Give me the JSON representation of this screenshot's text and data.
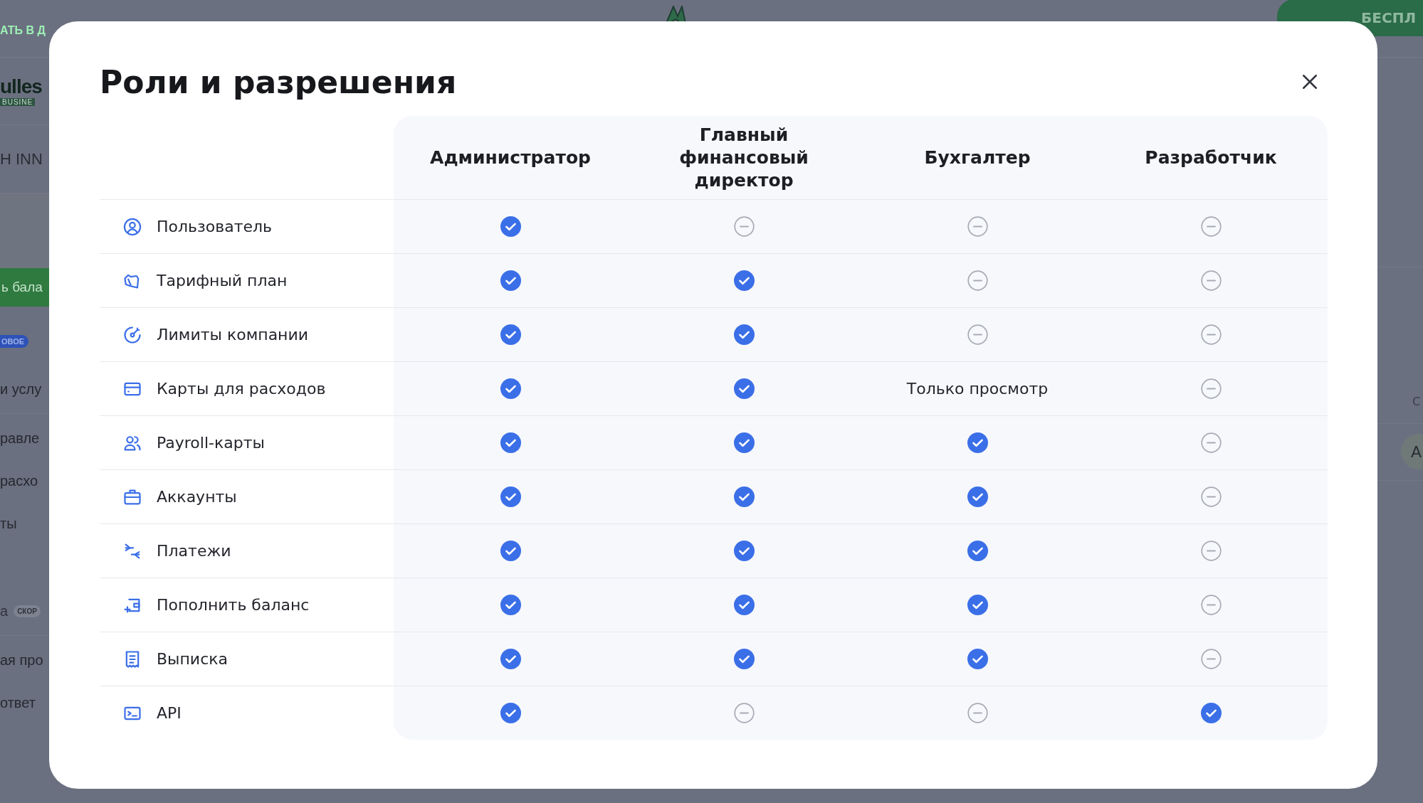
{
  "background": {
    "top_link": "АТЬ В Д",
    "trial_button": "БЕСПЛ",
    "logo": {
      "name": "ulles",
      "tag": "BUSINE"
    },
    "company": "Н INN",
    "topup_button": "ь бала",
    "sidebar": [
      {
        "kind": "badge",
        "text": "ОВОЕ"
      },
      {
        "kind": "item",
        "text": "и услу"
      },
      {
        "kind": "divider"
      },
      {
        "kind": "item",
        "text": "равле"
      },
      {
        "kind": "item",
        "text": "расхо"
      },
      {
        "kind": "item",
        "text": "ты"
      },
      {
        "kind": "item_badge",
        "text": "а",
        "badge": "СКОР"
      },
      {
        "kind": "divider"
      },
      {
        "kind": "item",
        "text": "ая про"
      },
      {
        "kind": "item",
        "text": "ответ"
      }
    ],
    "right": {
      "label": "С",
      "avatar": "А"
    }
  },
  "dialog": {
    "title": "Роли и разрешения",
    "columns": [
      "Администратор",
      "Главный финансовый директор",
      "Бухгалтер",
      "Разработчик"
    ],
    "rows": [
      {
        "label": "Пользователь",
        "cells": [
          {
            "kind": "check"
          },
          {
            "kind": "none"
          },
          {
            "kind": "none"
          },
          {
            "kind": "none"
          }
        ]
      },
      {
        "label": "Тарифный план",
        "cells": [
          {
            "kind": "check"
          },
          {
            "kind": "check"
          },
          {
            "kind": "none"
          },
          {
            "kind": "none"
          }
        ]
      },
      {
        "label": "Лимиты компании",
        "cells": [
          {
            "kind": "check"
          },
          {
            "kind": "check"
          },
          {
            "kind": "none"
          },
          {
            "kind": "none"
          }
        ]
      },
      {
        "label": "Карты для расходов",
        "cells": [
          {
            "kind": "check"
          },
          {
            "kind": "check"
          },
          {
            "kind": "text",
            "text": "Только просмотр"
          },
          {
            "kind": "none"
          }
        ]
      },
      {
        "label": "Payroll-карты",
        "cells": [
          {
            "kind": "check"
          },
          {
            "kind": "check"
          },
          {
            "kind": "check"
          },
          {
            "kind": "none"
          }
        ]
      },
      {
        "label": "Аккаунты",
        "cells": [
          {
            "kind": "check"
          },
          {
            "kind": "check"
          },
          {
            "kind": "check"
          },
          {
            "kind": "none"
          }
        ]
      },
      {
        "label": "Платежи",
        "cells": [
          {
            "kind": "check"
          },
          {
            "kind": "check"
          },
          {
            "kind": "check"
          },
          {
            "kind": "none"
          }
        ]
      },
      {
        "label": "Пополнить баланс",
        "cells": [
          {
            "kind": "check"
          },
          {
            "kind": "check"
          },
          {
            "kind": "check"
          },
          {
            "kind": "none"
          }
        ]
      },
      {
        "label": "Выписка",
        "cells": [
          {
            "kind": "check"
          },
          {
            "kind": "check"
          },
          {
            "kind": "check"
          },
          {
            "kind": "none"
          }
        ]
      },
      {
        "label": "API",
        "cells": [
          {
            "kind": "check"
          },
          {
            "kind": "none"
          },
          {
            "kind": "none"
          },
          {
            "kind": "check"
          }
        ]
      }
    ]
  }
}
